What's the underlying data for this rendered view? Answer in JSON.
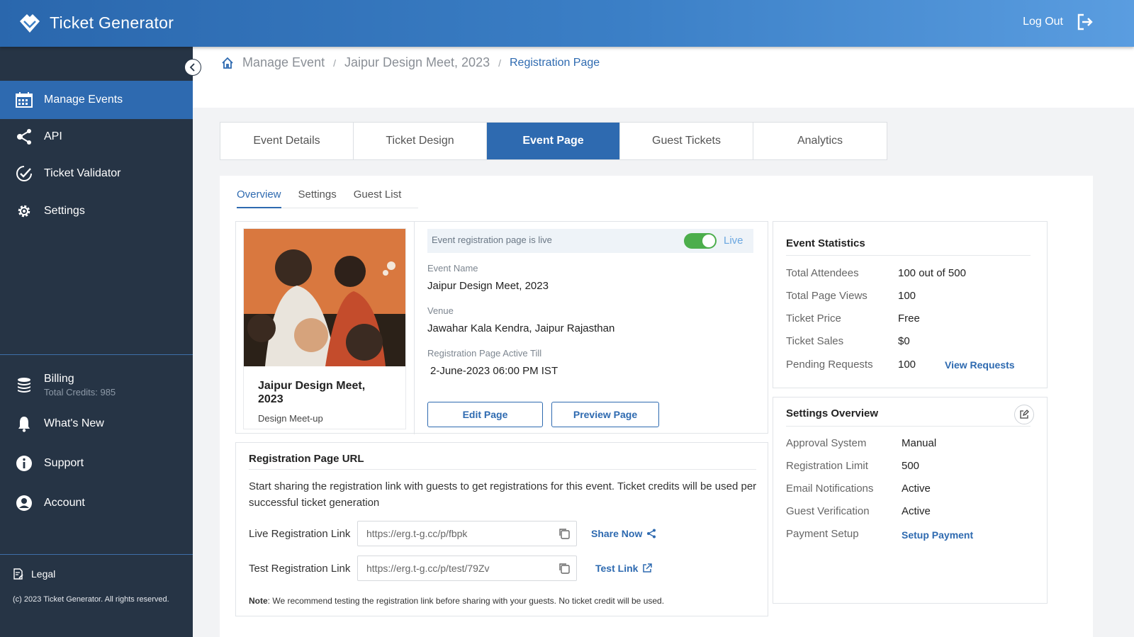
{
  "header": {
    "brand": "Ticket Generator",
    "logout": "Log Out"
  },
  "sidebar": {
    "items": [
      {
        "label": "Manage Events",
        "icon": "calendar-icon"
      },
      {
        "label": "API",
        "icon": "share-nodes-icon"
      },
      {
        "label": "Ticket Validator",
        "icon": "check-badge-icon"
      },
      {
        "label": "Settings",
        "icon": "gear-icon"
      }
    ],
    "billing": {
      "label": "Billing",
      "credits": "Total Credits: 985"
    },
    "bottom_items": [
      {
        "label": "What's New",
        "icon": "bell-icon"
      },
      {
        "label": "Support",
        "icon": "info-icon"
      },
      {
        "label": "Account",
        "icon": "user-icon"
      }
    ],
    "legal": "Legal",
    "copyright": "(c) 2023 Ticket Generator. All rights reserved."
  },
  "breadcrumb": {
    "root": "Manage Event",
    "event": "Jaipur Design Meet, 2023",
    "current": "Registration Page"
  },
  "tabs": [
    "Event Details",
    "Ticket Design",
    "Event Page",
    "Guest Tickets",
    "Analytics"
  ],
  "subtabs": [
    "Overview",
    "Settings",
    "Guest List"
  ],
  "event": {
    "title": "Jaipur Design Meet, 2023",
    "category": "Design Meet-up",
    "live_message": "Event registration page is live",
    "live_status": "Live",
    "name_label": "Event Name",
    "name": "Jaipur Design Meet, 2023",
    "venue_label": "Venue",
    "venue": "Jawahar Kala Kendra, Jaipur Rajasthan",
    "active_label": "Registration Page Active Till",
    "active_till": "2-June-2023 06:00 PM IST",
    "edit_button": "Edit Page",
    "preview_button": "Preview Page"
  },
  "registration": {
    "title": "Registration Page URL",
    "description": "Start sharing the registration link with guests to get registrations for this event. Ticket credits will be used per successful ticket generation",
    "live_label": "Live Registration Link",
    "live_url": "https://erg.t-g.cc/p/fbpk",
    "share": "Share Now",
    "test_label": "Test Registration Link",
    "test_url": "https://erg.t-g.cc/p/test/79Zv",
    "test_link": "Test Link",
    "note_bold": "Note",
    "note_text": ": We recommend testing the registration link before sharing with your guests. No ticket credit will be used."
  },
  "stats": {
    "title": "Event Statistics",
    "rows": [
      {
        "label": "Total Attendees",
        "value": "100 out of 500"
      },
      {
        "label": "Total Page Views",
        "value": "100"
      },
      {
        "label": "Ticket Price",
        "value": "Free"
      },
      {
        "label": "Ticket Sales",
        "value": "$0"
      },
      {
        "label": "Pending Requests",
        "value": "100"
      }
    ],
    "view_requests": "View Requests"
  },
  "settings_overview": {
    "title": "Settings Overview",
    "rows": [
      {
        "label": "Approval System",
        "value": "Manual"
      },
      {
        "label": "Registration Limit",
        "value": "500"
      },
      {
        "label": "Email Notifications",
        "value": "Active"
      },
      {
        "label": "Guest Verification",
        "value": "Active"
      },
      {
        "label": "Payment Setup",
        "value": ""
      }
    ],
    "setup_payment": "Setup Payment"
  },
  "colors": {
    "primary": "#2e6ab0",
    "sidebar": "#263445",
    "toggle_on": "#4cae4c"
  }
}
